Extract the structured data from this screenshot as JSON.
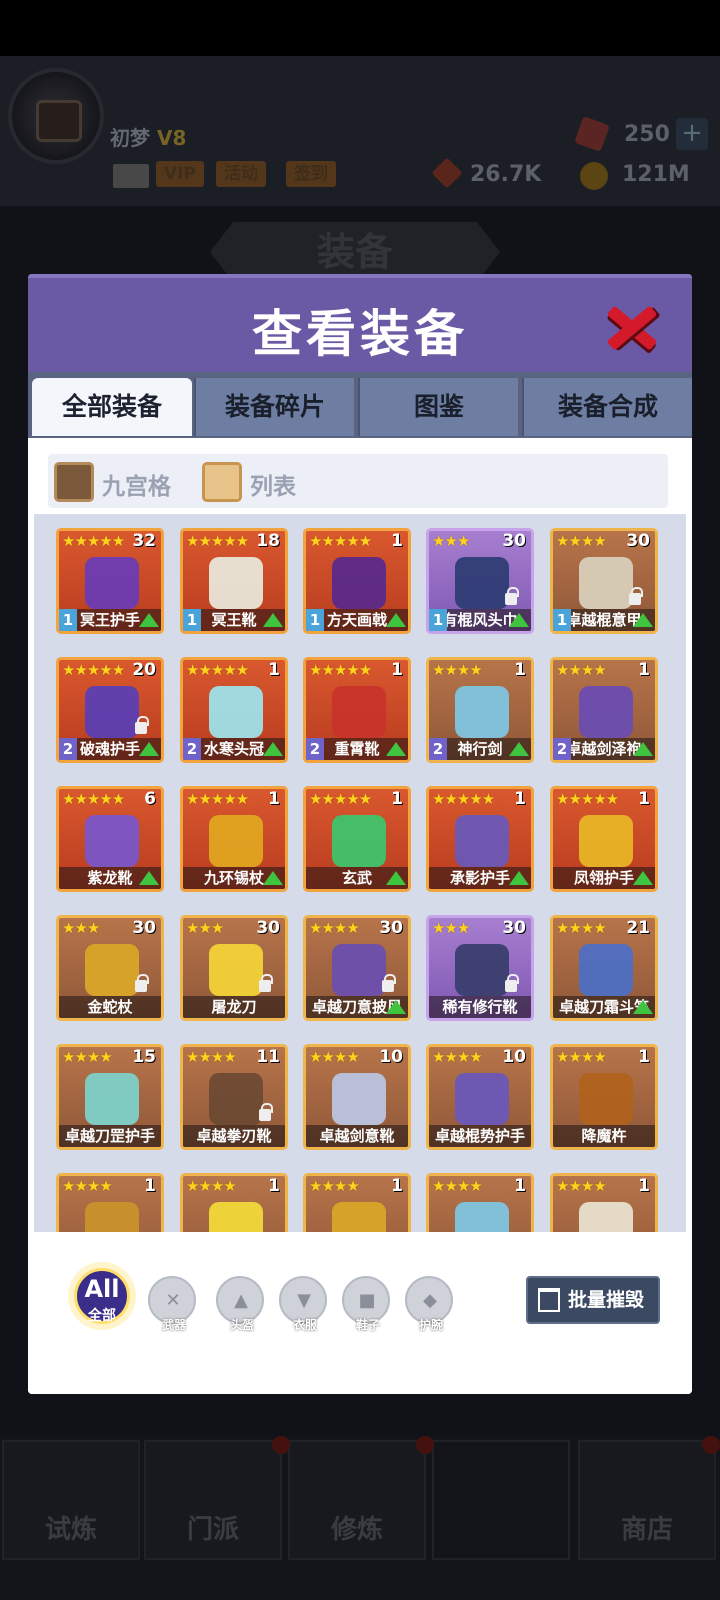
{
  "player": {
    "name": "初梦",
    "vip_level": "V8"
  },
  "header_buttons": {
    "vip": "VIP",
    "activity": "活动",
    "checkin": "签到"
  },
  "resources": {
    "gems": "250",
    "power": "26.7K",
    "coins": "121M"
  },
  "background_title": "装备",
  "bottom_nav": {
    "trial": "试炼",
    "sect": "门派",
    "cultivate": "修炼",
    "shop": "商店"
  },
  "dialog": {
    "title": "查看装备",
    "tabs": [
      "全部装备",
      "装备碎片",
      "图鉴",
      "装备合成"
    ],
    "views": {
      "grid": "九宫格",
      "list": "列表"
    },
    "items": [
      {
        "name": "冥王护手",
        "stars": 5,
        "count": "32",
        "rarity": "r5",
        "lvl": "1",
        "up": true,
        "lock": false,
        "color": "#6b3bb2"
      },
      {
        "name": "冥王靴",
        "stars": 5,
        "count": "18",
        "rarity": "r5",
        "lvl": "1",
        "up": true,
        "lock": false,
        "color": "#e8e6d8"
      },
      {
        "name": "方天画戟",
        "stars": 5,
        "count": "1",
        "rarity": "r5",
        "lvl": "1",
        "up": true,
        "lock": false,
        "color": "#5a2a8a"
      },
      {
        "name": "有棍风头巾",
        "stars": 3,
        "count": "30",
        "rarity": "r4p",
        "lvl": "1",
        "up": true,
        "lock": true,
        "color": "#2f3c74"
      },
      {
        "name": "卓越棍意甲",
        "stars": 4,
        "count": "30",
        "rarity": "r4",
        "lvl": "1",
        "up": true,
        "lock": true,
        "color": "#d8cfbb"
      },
      {
        "name": "破魂护手",
        "stars": 5,
        "count": "20",
        "rarity": "r5",
        "lvl": "2",
        "up": true,
        "lock": true,
        "color": "#5b3fb3"
      },
      {
        "name": "水寒头冠",
        "stars": 5,
        "count": "1",
        "rarity": "r5",
        "lvl": "2",
        "up": true,
        "lock": false,
        "color": "#9fe0e8"
      },
      {
        "name": "重霄靴",
        "stars": 5,
        "count": "1",
        "rarity": "r5",
        "lvl": "2",
        "up": true,
        "lock": false,
        "color": "#c8342a"
      },
      {
        "name": "神行剑",
        "stars": 4,
        "count": "1",
        "rarity": "r4",
        "lvl": "2",
        "up": true,
        "lock": false,
        "color": "#7fc5e0"
      },
      {
        "name": "卓越剑泽袍",
        "stars": 4,
        "count": "1",
        "rarity": "r4",
        "lvl": "2",
        "up": true,
        "lock": false,
        "color": "#6a4db0"
      },
      {
        "name": "紫龙靴",
        "stars": 5,
        "count": "6",
        "rarity": "r5",
        "lvl": "",
        "up": true,
        "lock": false,
        "color": "#7a56c8"
      },
      {
        "name": "九环锡杖",
        "stars": 5,
        "count": "1",
        "rarity": "r5",
        "lvl": "",
        "up": true,
        "lock": false,
        "color": "#e0a420"
      },
      {
        "name": "玄武",
        "stars": 5,
        "count": "1",
        "rarity": "r5",
        "lvl": "",
        "up": true,
        "lock": false,
        "color": "#3ec46a"
      },
      {
        "name": "承影护手",
        "stars": 5,
        "count": "1",
        "rarity": "r5",
        "lvl": "",
        "up": true,
        "lock": false,
        "color": "#6a58b8"
      },
      {
        "name": "凤翎护手",
        "stars": 5,
        "count": "1",
        "rarity": "r5",
        "lvl": "",
        "up": true,
        "lock": false,
        "color": "#e8b425"
      },
      {
        "name": "金蛇杖",
        "stars": 3,
        "count": "30",
        "rarity": "r4",
        "lvl": "",
        "up": false,
        "lock": true,
        "color": "#d9a528"
      },
      {
        "name": "屠龙刀",
        "stars": 3,
        "count": "30",
        "rarity": "r4",
        "lvl": "",
        "up": false,
        "lock": true,
        "color": "#f2d238"
      },
      {
        "name": "卓越刀意披风",
        "stars": 4,
        "count": "30",
        "rarity": "r4",
        "lvl": "",
        "up": true,
        "lock": true,
        "color": "#6b4fae"
      },
      {
        "name": "稀有修行靴",
        "stars": 3,
        "count": "30",
        "rarity": "r4p",
        "lvl": "",
        "up": false,
        "lock": true,
        "color": "#3a3e6e"
      },
      {
        "name": "卓越刀霜斗笠",
        "stars": 4,
        "count": "21",
        "rarity": "r4",
        "lvl": "",
        "up": true,
        "lock": false,
        "color": "#4d6fc4"
      },
      {
        "name": "卓越刀罡护手",
        "stars": 4,
        "count": "15",
        "rarity": "r4",
        "lvl": "",
        "up": false,
        "lock": false,
        "color": "#7dd0c8"
      },
      {
        "name": "卓越拳刃靴",
        "stars": 4,
        "count": "11",
        "rarity": "r4",
        "lvl": "",
        "up": false,
        "lock": true,
        "color": "#6e4a33"
      },
      {
        "name": "卓越剑意靴",
        "stars": 4,
        "count": "10",
        "rarity": "r4",
        "lvl": "",
        "up": false,
        "lock": false,
        "color": "#b9c4de"
      },
      {
        "name": "卓越棍势护手",
        "stars": 4,
        "count": "10",
        "rarity": "r4",
        "lvl": "",
        "up": false,
        "lock": false,
        "color": "#6a58b8"
      },
      {
        "name": "降魔杵",
        "stars": 4,
        "count": "1",
        "rarity": "r4",
        "lvl": "",
        "up": false,
        "lock": false,
        "color": "#b0621e"
      },
      {
        "name": "",
        "stars": 4,
        "count": "1",
        "rarity": "r4",
        "lvl": "",
        "up": false,
        "lock": false,
        "color": "#c9922c"
      },
      {
        "name": "",
        "stars": 4,
        "count": "1",
        "rarity": "r4",
        "lvl": "",
        "up": false,
        "lock": false,
        "color": "#f1d83a"
      },
      {
        "name": "",
        "stars": 4,
        "count": "1",
        "rarity": "r4",
        "lvl": "",
        "up": false,
        "lock": false,
        "color": "#d9a528"
      },
      {
        "name": "",
        "stars": 4,
        "count": "1",
        "rarity": "r4",
        "lvl": "",
        "up": false,
        "lock": false,
        "color": "#7fc5e0"
      },
      {
        "name": "",
        "stars": 4,
        "count": "1",
        "rarity": "r4",
        "lvl": "",
        "up": false,
        "lock": false,
        "color": "#e8e0cc"
      }
    ],
    "filters": {
      "all_top": "All",
      "all_bottom": "全部",
      "categories": [
        "武器",
        "头盔",
        "衣服",
        "鞋子",
        "护腕"
      ]
    },
    "batch_destroy": "批量摧毁"
  }
}
